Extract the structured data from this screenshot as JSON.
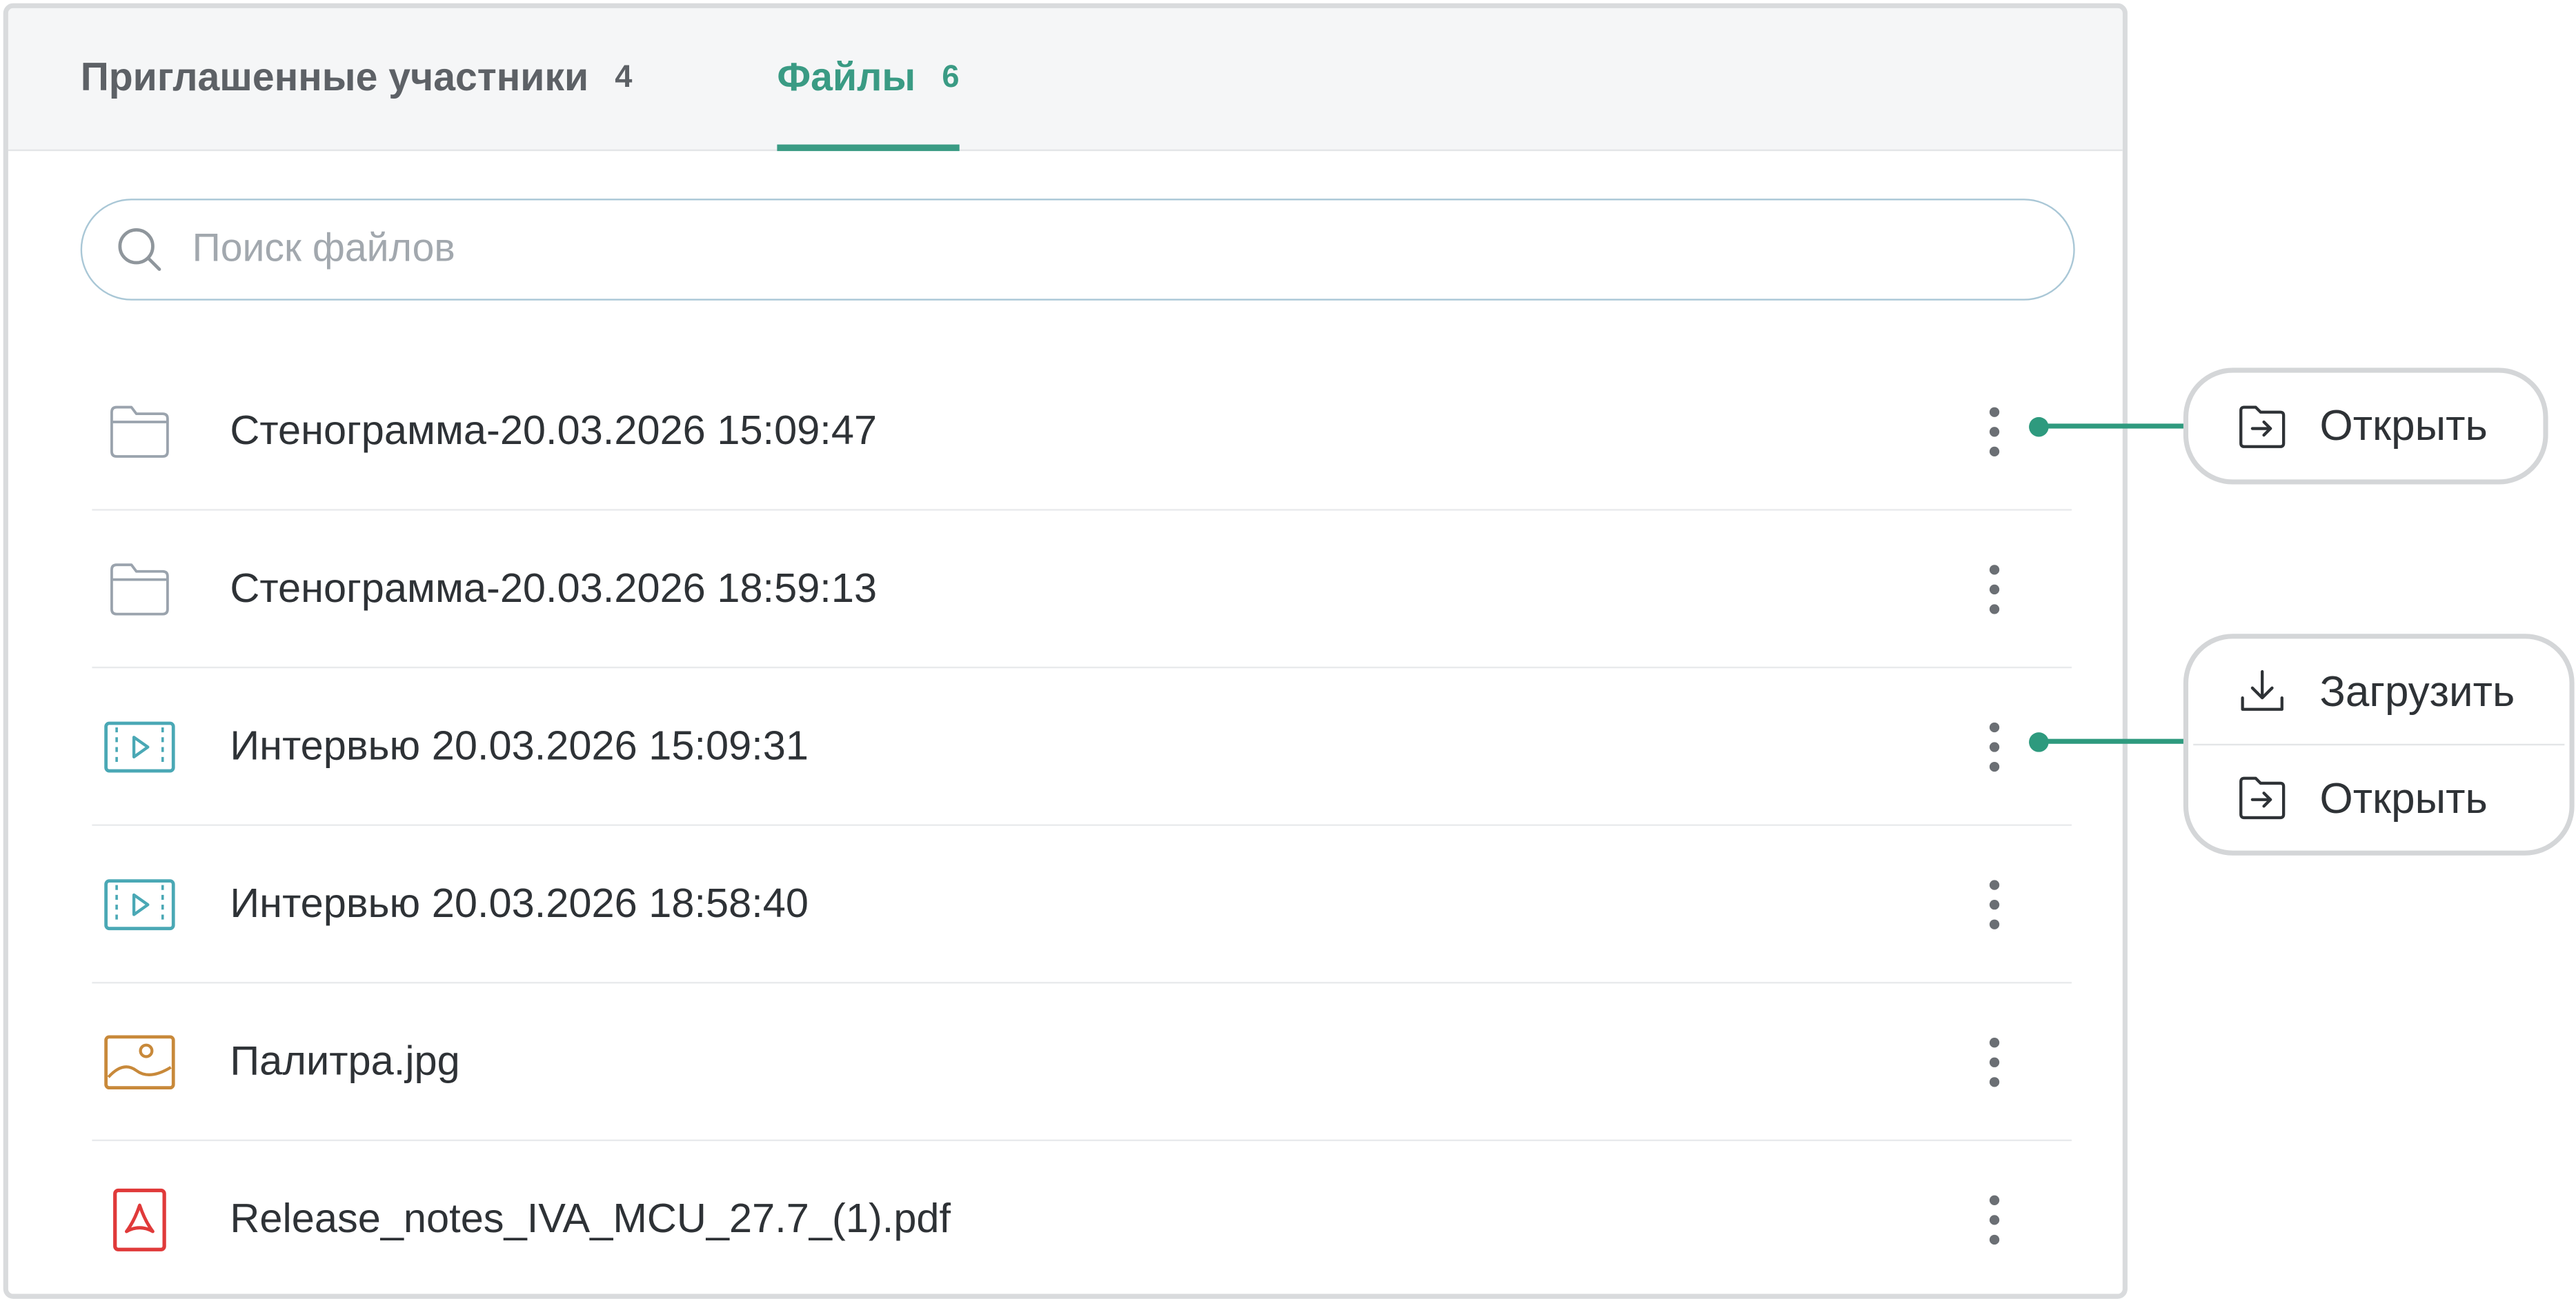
{
  "tabs": [
    {
      "label": "Приглашенные участники",
      "count": "4",
      "active": false
    },
    {
      "label": "Файлы",
      "count": "6",
      "active": true
    }
  ],
  "search": {
    "placeholder": "Поиск файлов",
    "icon": "search-icon"
  },
  "files": [
    {
      "name": "Стенограмма-20.03.2026 15:09:47",
      "icon": "folder-icon"
    },
    {
      "name": "Стенограмма-20.03.2026 18:59:13",
      "icon": "folder-icon"
    },
    {
      "name": "Интервью 20.03.2026 15:09:31",
      "icon": "video-file-icon"
    },
    {
      "name": "Интервью 20.03.2026 18:58:40",
      "icon": "video-file-icon"
    },
    {
      "name": "Палитра.jpg",
      "icon": "image-file-icon"
    },
    {
      "name": "Release_notes_IVA_MCU_27.7_(1).pdf",
      "icon": "pdf-file-icon"
    }
  ],
  "menus": {
    "folder_menu": {
      "items": [
        {
          "label": "Открыть",
          "icon": "open-icon"
        }
      ]
    },
    "video_menu": {
      "items": [
        {
          "label": "Загрузить",
          "icon": "download-icon"
        },
        {
          "label": "Открыть",
          "icon": "open-icon"
        }
      ]
    }
  },
  "colors": {
    "accent": "#3a9b84",
    "connector": "#2e9a7e",
    "video_icon": "#4aa8b5",
    "image_icon": "#c8893a",
    "pdf_icon": "#e03a3a",
    "folder_icon": "#9aa3ad"
  }
}
